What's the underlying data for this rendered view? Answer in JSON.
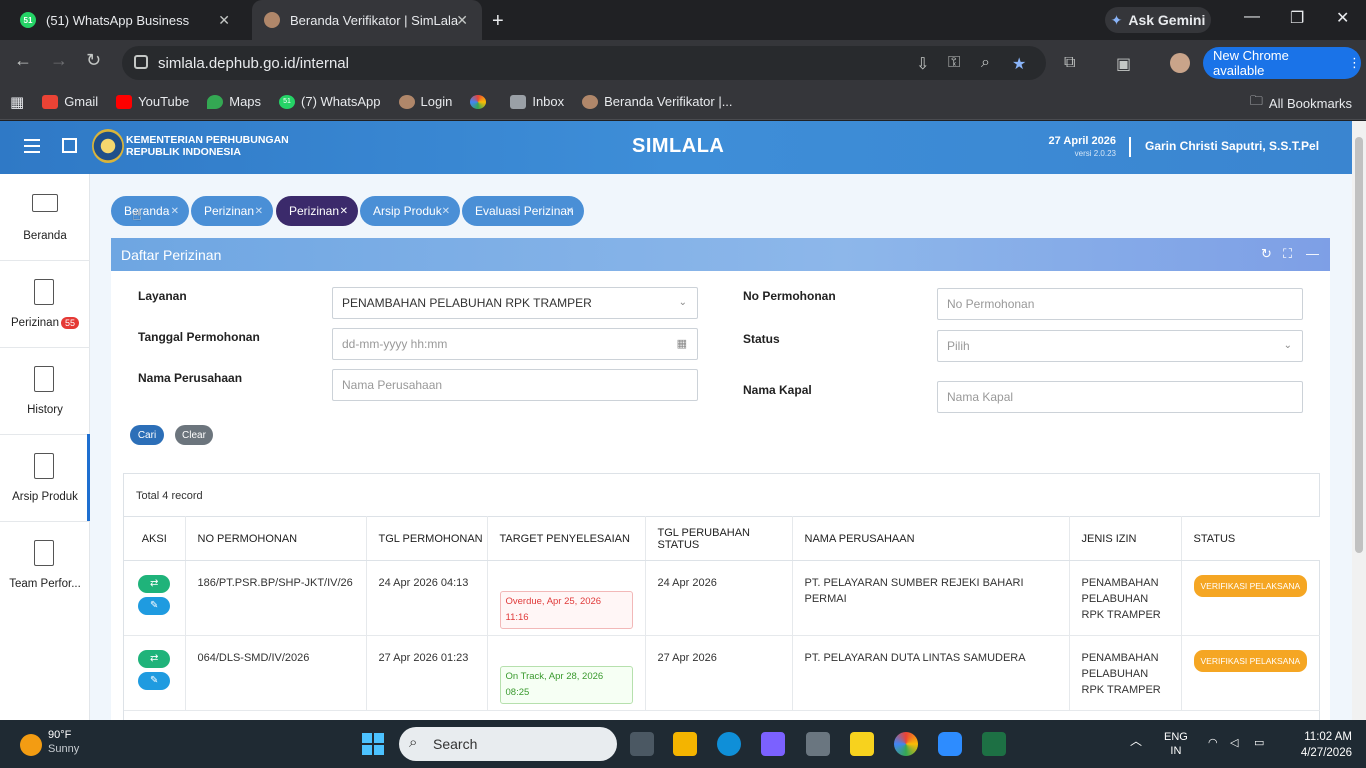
{
  "browser": {
    "tabs": [
      {
        "label": "(51) WhatsApp Business",
        "fav": "51"
      },
      {
        "label": "Beranda Verifikator | SimLala"
      }
    ],
    "ask_gemini": "Ask Gemini",
    "url": "simlala.dephub.go.id/internal",
    "new_chrome": "New Chrome available",
    "bookmarks": [
      "Gmail",
      "YouTube",
      "Maps",
      "(7) WhatsApp",
      "Login",
      "Inbox",
      "Beranda Verifikator |..."
    ],
    "bookmark_wa_badge": "51",
    "all_bookmarks": "All Bookmarks"
  },
  "header": {
    "org_line1": "KEMENTERIAN PERHUBUNGAN",
    "org_line2": "REPUBLIK INDONESIA",
    "app_title": "SIMLALA",
    "date": "27 April 2026",
    "version": "versi 2.0.23",
    "user": "Garin Christi Saputri, S.S.T.Pel"
  },
  "sidebar": {
    "items": [
      {
        "label": "Beranda"
      },
      {
        "label": "Perizinan",
        "badge": "55"
      },
      {
        "label": "History"
      },
      {
        "label": "Arsip Produk"
      },
      {
        "label": "Team Perfor..."
      }
    ]
  },
  "tabs": [
    {
      "label": "Beranda"
    },
    {
      "label": "Perizinan"
    },
    {
      "label": "Perizinan"
    },
    {
      "label": "Arsip Produk"
    },
    {
      "label": "Evaluasi Perizinan"
    }
  ],
  "panel": {
    "title": "Daftar Perizinan",
    "form": {
      "layanan_label": "Layanan",
      "layanan_value": "PENAMBAHAN PELABUHAN RPK TRAMPER",
      "tanggal_label": "Tanggal Permohonan",
      "tanggal_placeholder": "dd-mm-yyyy hh:mm",
      "nama_perusahaan_label": "Nama Perusahaan",
      "nama_perusahaan_placeholder": "Nama Perusahaan",
      "no_permohonan_label": "No Permohonan",
      "no_permohonan_placeholder": "No Permohonan",
      "status_label": "Status",
      "status_placeholder": "Pilih",
      "nama_kapal_label": "Nama Kapal",
      "nama_kapal_placeholder": "Nama Kapal",
      "cari": "Cari",
      "clear": "Clear"
    },
    "table": {
      "total": "Total 4 record",
      "columns": [
        "AKSI",
        "NO PERMOHONAN",
        "TGL PERMOHONAN",
        "TARGET PENYELESAIAN",
        "TGL PERUBAHAN STATUS",
        "NAMA PERUSAHAAN",
        "JENIS IZIN",
        "STATUS"
      ],
      "rows": [
        {
          "no": "186/PT.PSR.BP/SHP-JKT/IV/26",
          "tgl": "24 Apr 2026 04:13",
          "target": "Overdue, Apr 25, 2026 11:16",
          "tgl_status": "24 Apr 2026",
          "perusahaan": "PT. PELAYARAN SUMBER REJEKI BAHARI PERMAI",
          "jenis": "PENAMBAHAN PELABUHAN RPK TRAMPER",
          "status": "VERIFIKASI PELAKSANA"
        },
        {
          "no": "064/DLS-SMD/IV/2026",
          "tgl": "27 Apr 2026 01:23",
          "target": "On Track, Apr 28, 2026 08:25",
          "tgl_status": "27 Apr 2026",
          "perusahaan": "PT. PELAYARAN DUTA LINTAS SAMUDERA",
          "jenis": "PENAMBAHAN PELABUHAN RPK TRAMPER",
          "status": "VERIFIKASI PELAKSANA"
        }
      ]
    }
  },
  "taskbar": {
    "temp": "90°F",
    "weather": "Sunny",
    "search": "Search",
    "lang1": "ENG",
    "lang2": "IN",
    "time": "11:02 AM",
    "date": "4/27/2026"
  },
  "colors": {
    "header_blue": "#3a85d0",
    "pill_blue": "#4a8fd6",
    "pill_active": "#3b2a6b",
    "status_orange": "#f5a623",
    "overdue_red": "#e03b3b",
    "ontrack_green": "#3a9a2e"
  }
}
